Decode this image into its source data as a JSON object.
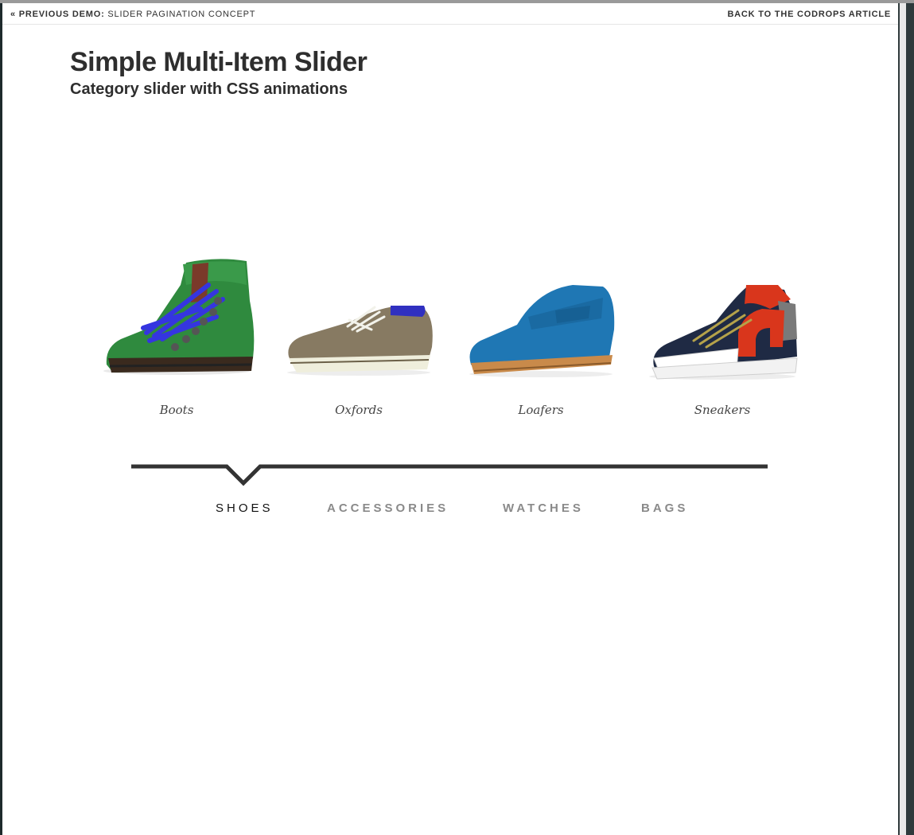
{
  "topbar": {
    "prev_prefix": "« Previous Demo:",
    "prev_title": "Slider Pagination Concept",
    "back_link": "Back to the Codrops Article"
  },
  "header": {
    "title": "Simple Multi-Item Slider",
    "subtitle": "Category slider with CSS animations"
  },
  "slider": {
    "items": [
      {
        "label": "Boots",
        "image": "green-hiking-boot-blue-laces"
      },
      {
        "label": "Oxfords",
        "image": "taupe-oxford-shoe"
      },
      {
        "label": "Loafers",
        "image": "blue-penny-loafer"
      },
      {
        "label": "Sneakers",
        "image": "navy-white-red-hightop-sneaker"
      }
    ]
  },
  "nav": {
    "tabs": [
      {
        "label": "Shoes",
        "active": true
      },
      {
        "label": "Accessories",
        "active": false
      },
      {
        "label": "Watches",
        "active": false
      },
      {
        "label": "Bags",
        "active": false
      }
    ]
  },
  "colors": {
    "text": "#2e2e2e",
    "inactive_tab": "#8a8a8a",
    "nav_line": "#333333"
  }
}
